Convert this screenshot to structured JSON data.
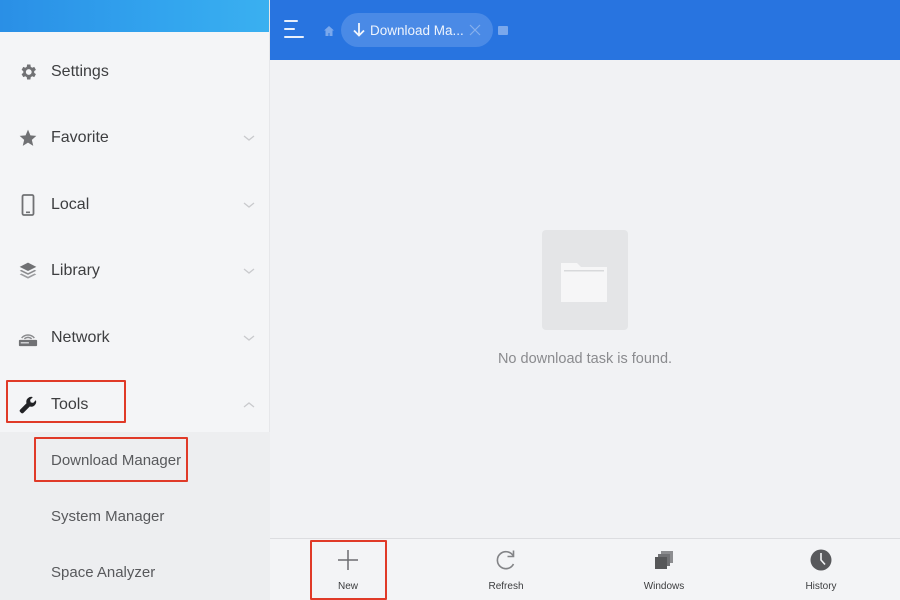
{
  "sidebar": {
    "items": [
      {
        "label": "Settings",
        "icon": "gear-icon",
        "expandable": false
      },
      {
        "label": "Favorite",
        "icon": "star-icon",
        "expandable": true,
        "expanded": false
      },
      {
        "label": "Local",
        "icon": "phone-icon",
        "expandable": true,
        "expanded": false
      },
      {
        "label": "Library",
        "icon": "layers-icon",
        "expandable": true,
        "expanded": false
      },
      {
        "label": "Network",
        "icon": "router-icon",
        "expandable": true,
        "expanded": false
      },
      {
        "label": "Tools",
        "icon": "wrench-icon",
        "expandable": true,
        "expanded": true
      }
    ],
    "tools_subitems": [
      {
        "label": "Download Manager"
      },
      {
        "label": "System Manager"
      },
      {
        "label": "Space Analyzer"
      }
    ]
  },
  "header": {
    "menu_icon": "hamburger-icon",
    "home_icon": "home-icon",
    "active_tab": {
      "icon": "download-arrow-icon",
      "label": "Download Ma..."
    },
    "tab_switcher_icon": "tab-switcher-icon"
  },
  "main": {
    "empty_icon": "folder-icon",
    "empty_message": "No download task is found."
  },
  "toolbar": {
    "buttons": [
      {
        "label": "New",
        "icon": "plus-icon"
      },
      {
        "label": "Refresh",
        "icon": "refresh-icon"
      },
      {
        "label": "Windows",
        "icon": "windows-stack-icon"
      },
      {
        "label": "History",
        "icon": "clock-icon"
      }
    ]
  },
  "colors": {
    "header_blue": "#2874e0",
    "highlight_red": "#e03a28",
    "sidebar_bg": "#f4f5f7"
  }
}
